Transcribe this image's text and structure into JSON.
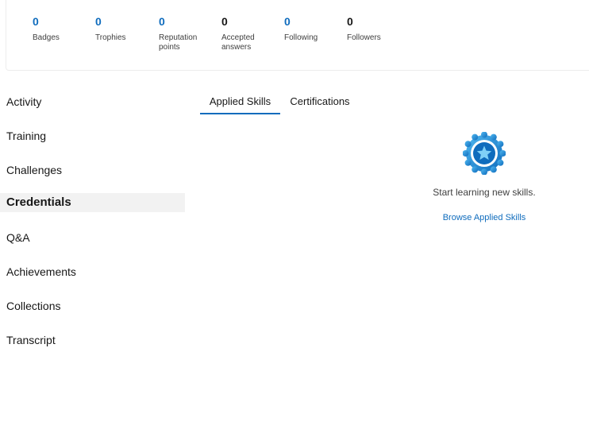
{
  "stats": [
    {
      "value": "0",
      "label": "Badges",
      "accent": true
    },
    {
      "value": "0",
      "label": "Trophies",
      "accent": true
    },
    {
      "value": "0",
      "label": "Reputation points",
      "accent": true
    },
    {
      "value": "0",
      "label": "Accepted answers",
      "accent": false
    },
    {
      "value": "0",
      "label": "Following",
      "accent": true
    },
    {
      "value": "0",
      "label": "Followers",
      "accent": false
    }
  ],
  "sidebar": {
    "items": [
      {
        "label": "Activity",
        "active": false
      },
      {
        "label": "Training",
        "active": false
      },
      {
        "label": "Challenges",
        "active": false
      },
      {
        "label": "Credentials",
        "active": true
      },
      {
        "label": "Q&A",
        "active": false
      },
      {
        "label": "Achievements",
        "active": false
      },
      {
        "label": "Collections",
        "active": false
      },
      {
        "label": "Transcript",
        "active": false
      }
    ]
  },
  "tabs": [
    {
      "label": "Applied Skills",
      "active": true
    },
    {
      "label": "Certifications",
      "active": false
    }
  ],
  "empty_state": {
    "icon": "star-badge-icon",
    "message": "Start learning new skills.",
    "link_label": "Browse Applied Skills"
  },
  "colors": {
    "accent": "#0f6cbd",
    "badge_light": "#50b8f0",
    "active_bg": "#f2f2f2"
  }
}
